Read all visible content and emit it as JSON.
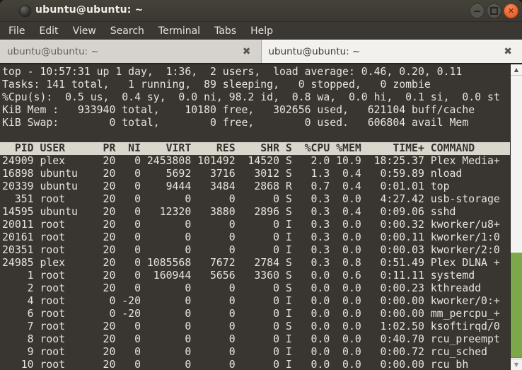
{
  "window": {
    "title": "ubuntu@ubuntu: ~"
  },
  "menu": {
    "items": [
      "File",
      "Edit",
      "View",
      "Search",
      "Terminal",
      "Tabs",
      "Help"
    ]
  },
  "tabs": [
    {
      "label": "ubuntu@ubuntu: ~",
      "active": false
    },
    {
      "label": "ubuntu@ubuntu: ~",
      "active": true
    }
  ],
  "icons": {
    "tab_close": "✖",
    "window_close": "✕",
    "scroll_up": "▲",
    "scroll_down": "▼"
  },
  "terminal": {
    "summary": [
      "top - 10:57:31 up 1 day,  1:36,  2 users,  load average: 0.46, 0.20, 0.11",
      "Tasks: 141 total,   1 running,  89 sleeping,   0 stopped,   0 zombie",
      "%Cpu(s):  0.5 us,  0.4 sy,  0.0 ni, 98.2 id,  0.8 wa,  0.0 hi,  0.1 si,  0.0 st",
      "KiB Mem :   933940 total,    10180 free,   302656 used,   621104 buff/cache",
      "KiB Swap:        0 total,        0 free,        0 used.   606804 avail Mem"
    ],
    "columns": [
      "PID",
      "USER",
      "PR",
      "NI",
      "VIRT",
      "RES",
      "SHR",
      "S",
      "%CPU",
      "%MEM",
      "TIME+",
      "COMMAND"
    ],
    "processes": [
      {
        "pid": "24909",
        "user": "plex",
        "pr": "20",
        "ni": "0",
        "virt": "2453808",
        "res": "101492",
        "shr": "14520",
        "s": "S",
        "cpu": "2.0",
        "mem": "10.9",
        "time": "18:25.37",
        "command": "Plex Media+"
      },
      {
        "pid": "16898",
        "user": "ubuntu",
        "pr": "20",
        "ni": "0",
        "virt": "5692",
        "res": "3716",
        "shr": "3012",
        "s": "S",
        "cpu": "1.3",
        "mem": "0.4",
        "time": "0:59.89",
        "command": "nload"
      },
      {
        "pid": "20339",
        "user": "ubuntu",
        "pr": "20",
        "ni": "0",
        "virt": "9444",
        "res": "3484",
        "shr": "2868",
        "s": "R",
        "cpu": "0.7",
        "mem": "0.4",
        "time": "0:01.01",
        "command": "top"
      },
      {
        "pid": "351",
        "user": "root",
        "pr": "20",
        "ni": "0",
        "virt": "0",
        "res": "0",
        "shr": "0",
        "s": "S",
        "cpu": "0.3",
        "mem": "0.0",
        "time": "4:27.42",
        "command": "usb-storage"
      },
      {
        "pid": "14595",
        "user": "ubuntu",
        "pr": "20",
        "ni": "0",
        "virt": "12320",
        "res": "3880",
        "shr": "2896",
        "s": "S",
        "cpu": "0.3",
        "mem": "0.4",
        "time": "0:09.06",
        "command": "sshd"
      },
      {
        "pid": "20011",
        "user": "root",
        "pr": "20",
        "ni": "0",
        "virt": "0",
        "res": "0",
        "shr": "0",
        "s": "I",
        "cpu": "0.3",
        "mem": "0.0",
        "time": "0:00.32",
        "command": "kworker/u8+"
      },
      {
        "pid": "20161",
        "user": "root",
        "pr": "20",
        "ni": "0",
        "virt": "0",
        "res": "0",
        "shr": "0",
        "s": "I",
        "cpu": "0.3",
        "mem": "0.0",
        "time": "0:00.11",
        "command": "kworker/1:0"
      },
      {
        "pid": "20351",
        "user": "root",
        "pr": "20",
        "ni": "0",
        "virt": "0",
        "res": "0",
        "shr": "0",
        "s": "I",
        "cpu": "0.3",
        "mem": "0.0",
        "time": "0:00.03",
        "command": "kworker/2:0"
      },
      {
        "pid": "24985",
        "user": "plex",
        "pr": "20",
        "ni": "0",
        "virt": "1085568",
        "res": "7672",
        "shr": "2784",
        "s": "S",
        "cpu": "0.3",
        "mem": "0.8",
        "time": "0:51.49",
        "command": "Plex DLNA +"
      },
      {
        "pid": "1",
        "user": "root",
        "pr": "20",
        "ni": "0",
        "virt": "160944",
        "res": "5656",
        "shr": "3360",
        "s": "S",
        "cpu": "0.0",
        "mem": "0.6",
        "time": "0:11.11",
        "command": "systemd"
      },
      {
        "pid": "2",
        "user": "root",
        "pr": "20",
        "ni": "0",
        "virt": "0",
        "res": "0",
        "shr": "0",
        "s": "S",
        "cpu": "0.0",
        "mem": "0.0",
        "time": "0:00.23",
        "command": "kthreadd"
      },
      {
        "pid": "4",
        "user": "root",
        "pr": "0",
        "ni": "-20",
        "virt": "0",
        "res": "0",
        "shr": "0",
        "s": "I",
        "cpu": "0.0",
        "mem": "0.0",
        "time": "0:00.00",
        "command": "kworker/0:+"
      },
      {
        "pid": "6",
        "user": "root",
        "pr": "0",
        "ni": "-20",
        "virt": "0",
        "res": "0",
        "shr": "0",
        "s": "I",
        "cpu": "0.0",
        "mem": "0.0",
        "time": "0:00.00",
        "command": "mm_percpu_+"
      },
      {
        "pid": "7",
        "user": "root",
        "pr": "20",
        "ni": "0",
        "virt": "0",
        "res": "0",
        "shr": "0",
        "s": "S",
        "cpu": "0.0",
        "mem": "0.0",
        "time": "1:02.50",
        "command": "ksoftirqd/0"
      },
      {
        "pid": "8",
        "user": "root",
        "pr": "20",
        "ni": "0",
        "virt": "0",
        "res": "0",
        "shr": "0",
        "s": "I",
        "cpu": "0.0",
        "mem": "0.0",
        "time": "0:40.70",
        "command": "rcu_preempt"
      },
      {
        "pid": "9",
        "user": "root",
        "pr": "20",
        "ni": "0",
        "virt": "0",
        "res": "0",
        "shr": "0",
        "s": "I",
        "cpu": "0.0",
        "mem": "0.0",
        "time": "0:00.72",
        "command": "rcu_sched"
      },
      {
        "pid": "10",
        "user": "root",
        "pr": "20",
        "ni": "0",
        "virt": "0",
        "res": "0",
        "shr": "0",
        "s": "I",
        "cpu": "0.0",
        "mem": "0.0",
        "time": "0:00.00",
        "command": "rcu_bh"
      }
    ]
  },
  "colors": {
    "titlebar_bg": "#3e3b36",
    "terminal_bg": "#393631",
    "terminal_fg": "#e7e4da",
    "table_header_bg": "#d9d6cc",
    "table_header_fg": "#33312c",
    "close_button_orange": "#e85e2c",
    "scrollbar_thumb_green": "#7da74b",
    "tab_active_bg": "#f3f1ee",
    "tab_inactive_bg": "#d6d3cf"
  }
}
